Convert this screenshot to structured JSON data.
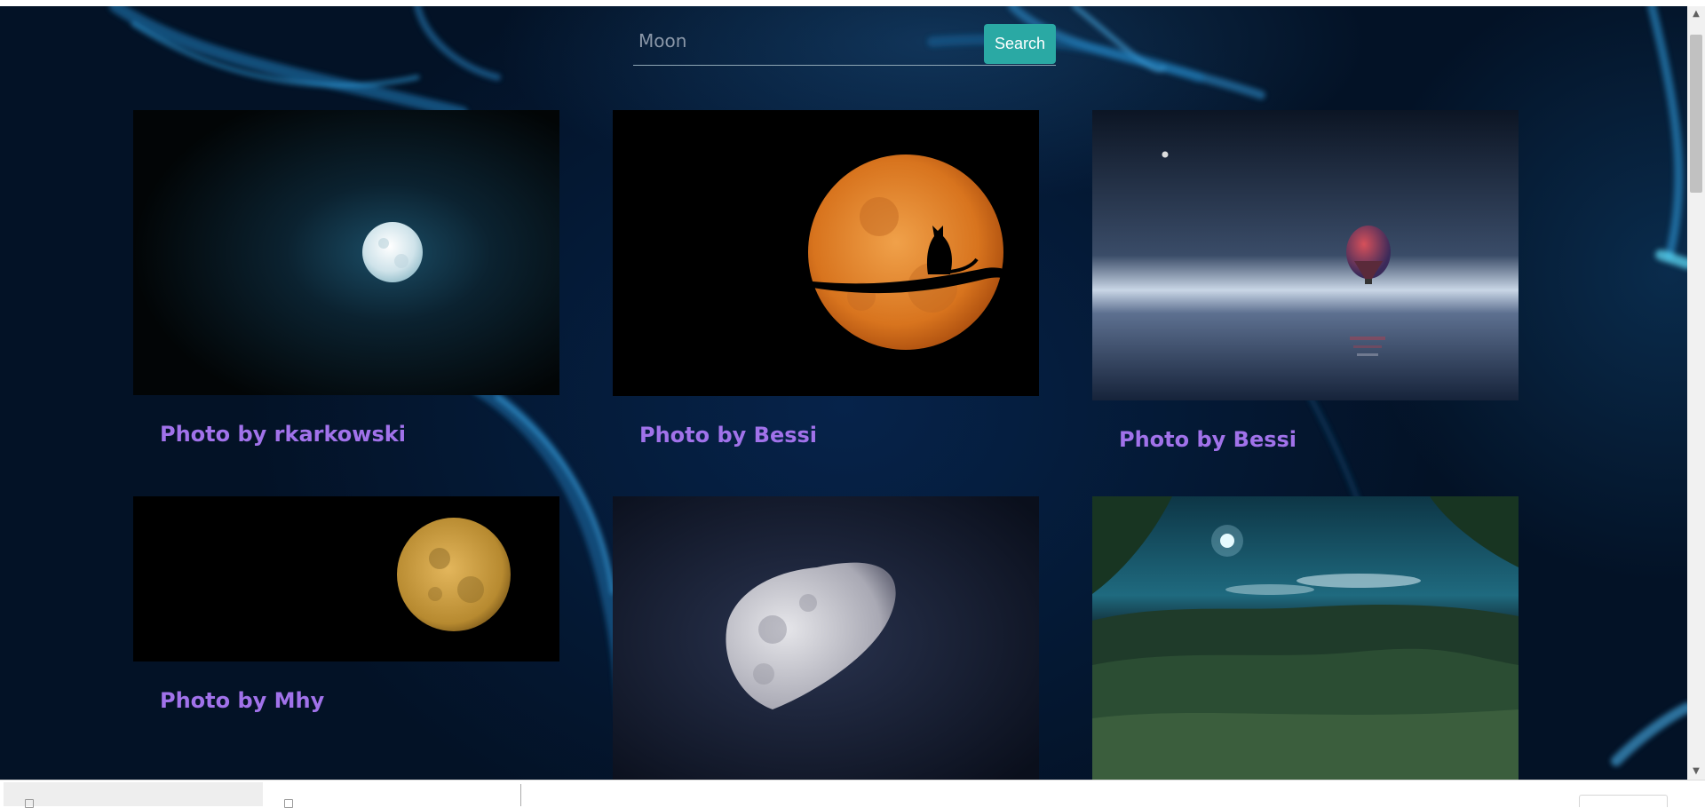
{
  "search": {
    "value": "Moon",
    "button_label": "Search"
  },
  "cards": [
    {
      "caption": "Photo by rkarkowski"
    },
    {
      "caption": "Photo by Bessi"
    },
    {
      "caption": "Photo by Bessi"
    },
    {
      "caption": "Photo by Mhy"
    },
    {
      "caption": ""
    },
    {
      "caption": ""
    }
  ],
  "colors": {
    "accent_button": "#2aa9a4",
    "caption_text": "#a172ea",
    "background": "#031226"
  }
}
